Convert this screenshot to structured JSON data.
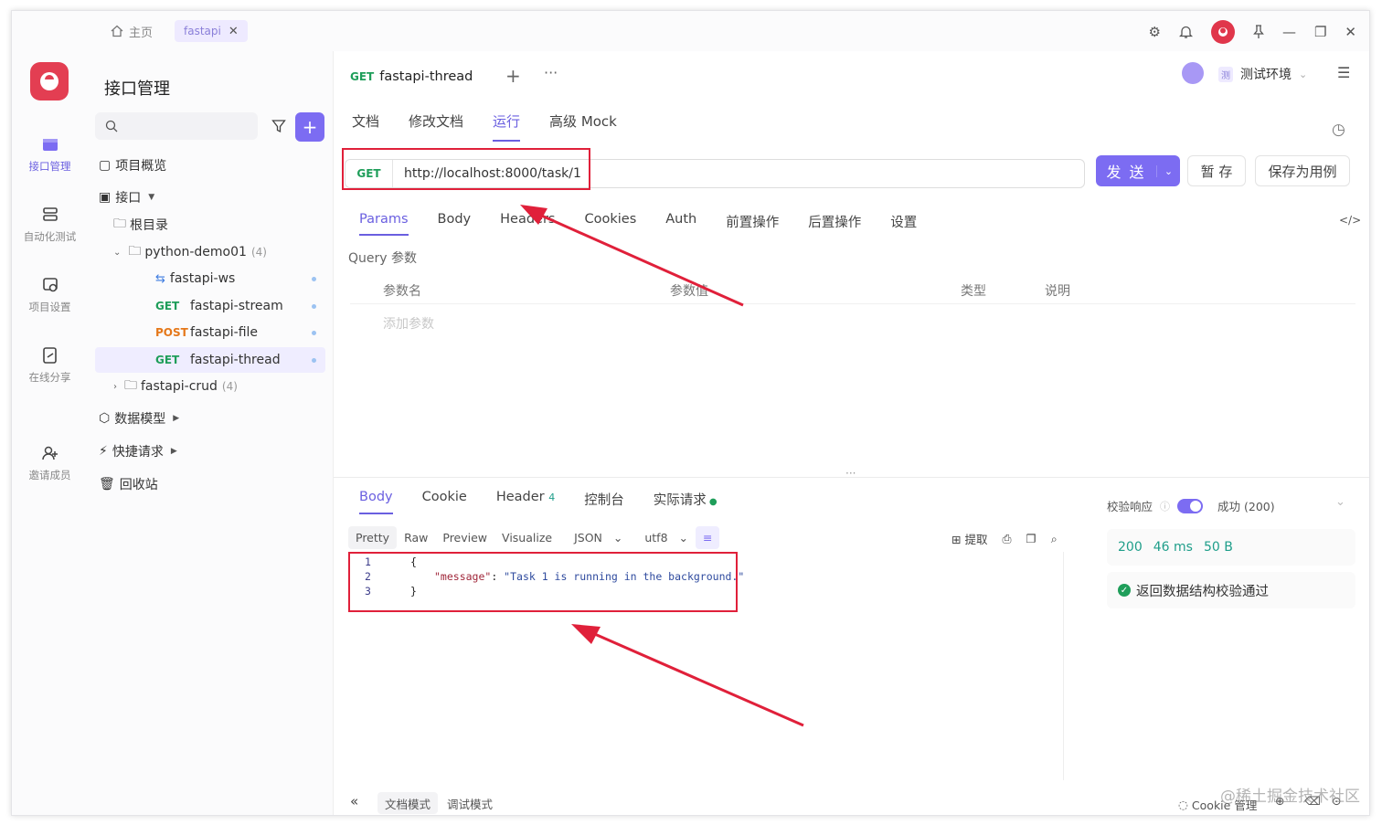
{
  "titlebar": {
    "home_label": "主页",
    "project_tab": "fastapi"
  },
  "rail": {
    "items": [
      {
        "label": "接口管理"
      },
      {
        "label": "自动化测试"
      },
      {
        "label": "项目设置"
      },
      {
        "label": "在线分享"
      },
      {
        "label": "邀请成员"
      }
    ]
  },
  "tree": {
    "title": "接口管理",
    "overview": "项目概览",
    "interfaces": "接口",
    "root": "根目录",
    "folder1": {
      "name": "python-demo01",
      "count": "(4)"
    },
    "items": [
      {
        "method": "",
        "name": "fastapi-ws"
      },
      {
        "method": "GET",
        "name": "fastapi-stream"
      },
      {
        "method": "POST",
        "name": "fastapi-file"
      },
      {
        "method": "GET",
        "name": "fastapi-thread"
      }
    ],
    "folder2": {
      "name": "fastapi-crud",
      "count": "(4)"
    },
    "models": "数据模型",
    "quick": "快捷请求",
    "trash": "回收站"
  },
  "api": {
    "method": "GET",
    "name": "fastapi-thread",
    "env": "测试环境",
    "env_badge": "测",
    "tabs": [
      "文档",
      "修改文档",
      "运行",
      "高级 Mock"
    ],
    "url": "http://localhost:8000/task/1",
    "send": "发 送",
    "save_temp": "暂 存",
    "save_case": "保存为用例"
  },
  "request": {
    "tabs": [
      "Params",
      "Body",
      "Headers",
      "Cookies",
      "Auth",
      "前置操作",
      "后置操作",
      "设置"
    ],
    "query_label": "Query 参数",
    "columns": [
      "参数名",
      "参数值",
      "类型",
      "说明"
    ],
    "add_param": "添加参数"
  },
  "response": {
    "tabs": [
      "Body",
      "Cookie",
      "Header",
      "控制台",
      "实际请求"
    ],
    "header_count": "4",
    "formats": [
      "Pretty",
      "Raw",
      "Preview",
      "Visualize",
      "JSON",
      "utf8"
    ],
    "extract": "提取",
    "code": {
      "l1": "{",
      "key": "\"message\"",
      "colon": ": ",
      "val": "\"Task 1 is running in the background.\"",
      "l3": "}",
      "n1": "1",
      "n2": "2",
      "n3": "3"
    },
    "validate_label": "校验响应",
    "validate_status": "成功 (200)",
    "status_code": "200",
    "time": "46 ms",
    "size": "50 B",
    "schema_ok": "返回数据结构校验通过"
  },
  "footer": {
    "doc_mode": "文档模式",
    "debug_mode": "调试模式",
    "cookie_mgr": "Cookie 管理",
    "watermark": "@稀土掘金技术社区"
  },
  "colors": {
    "accent": "#7c6cf2",
    "get": "#1f9e5a",
    "post": "#e5781a",
    "annotation": "#e0203a"
  }
}
